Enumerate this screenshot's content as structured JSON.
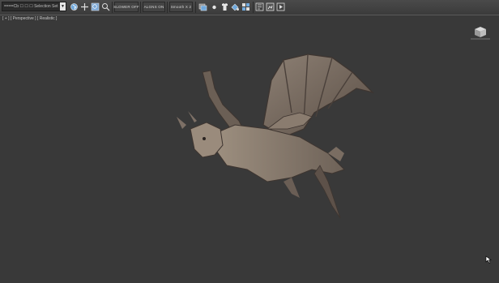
{
  "toolbar": {
    "selection_dropdown": "====Cb  ☐ ☐ ☐ Selection Set",
    "toggle_1": "SLOWER OFF",
    "toggle_2": "ALGNS ON",
    "toggle_3": "Smooth X 2"
  },
  "viewport": {
    "label": "[ + ] [ Perspective ] [ Realistic ]"
  },
  "colors": {
    "viewport_bg": "#393939",
    "toolbar_bg": "#404040",
    "accent_blue": "#6fa8dc"
  },
  "icons": [
    "select-object-icon",
    "move-icon",
    "zoom-icon",
    "zoom-all-icon",
    "layers-icon",
    "sphere-icon",
    "shirt-icon",
    "paint-icon",
    "grid-icon",
    "render-setup-icon",
    "render-frame-icon",
    "view-cube-icon",
    "mouse-cursor-icon"
  ]
}
